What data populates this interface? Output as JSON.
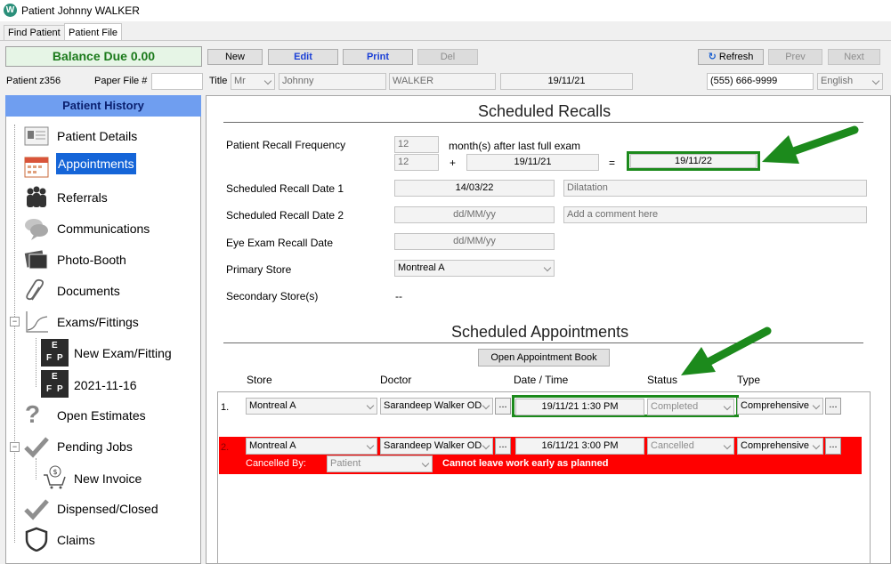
{
  "window": {
    "title": "Patient Johnny WALKER",
    "icon": "W"
  },
  "tabs": [
    {
      "label": "Find Patient"
    },
    {
      "label": "Patient File"
    }
  ],
  "balance": "Balance Due 0.00",
  "toolbar": {
    "new": "New",
    "edit": "Edit",
    "print": "Print",
    "del": "Del",
    "refresh": "Refresh",
    "prev": "Prev",
    "next": "Next"
  },
  "patient": {
    "id_label": "Patient z356",
    "paper_file_label": "Paper File #",
    "paper_file_value": "",
    "title_label": "Title",
    "title_value": "Mr",
    "first_name": "Johnny",
    "last_name": "WALKER",
    "date": "19/11/21",
    "phone": "(555) 666-9999",
    "language": "English"
  },
  "sidebar": {
    "header": "Patient History",
    "items": [
      {
        "label": "Patient Details",
        "icon": "patient-card-icon"
      },
      {
        "label": "Appointments",
        "icon": "calendar-icon"
      },
      {
        "label": "Referrals",
        "icon": "people-icon"
      },
      {
        "label": "Communications",
        "icon": "speech-bubbles-icon"
      },
      {
        "label": "Photo-Booth",
        "icon": "photos-icon"
      },
      {
        "label": "Documents",
        "icon": "paperclip-icon"
      },
      {
        "label": "Exams/Fittings",
        "icon": "chart-icon"
      },
      {
        "label": "New Exam/Fitting",
        "icon": "eye-chart-icon"
      },
      {
        "label": "2021-11-16",
        "icon": "eye-chart-icon"
      },
      {
        "label": "Open Estimates",
        "icon": "question-icon"
      },
      {
        "label": "Pending Jobs",
        "icon": "checkmark-icon"
      },
      {
        "label": "New Invoice",
        "icon": "cart-icon"
      },
      {
        "label": "Dispensed/Closed",
        "icon": "checkmark-icon"
      },
      {
        "label": "Claims",
        "icon": "shield-icon"
      }
    ],
    "ep_letters": {
      "e": "E",
      "f": "F",
      "p": "P"
    }
  },
  "recalls": {
    "title": "Scheduled Recalls",
    "frequency_label": "Patient Recall Frequency",
    "frequency_value": "12",
    "frequency_suffix": "month(s) after last full exam",
    "calc_months": "12",
    "plus": "+",
    "calc_date": "19/11/21",
    "equals": "=",
    "calc_result": "19/11/22",
    "recall1_label": "Scheduled Recall Date 1",
    "recall1_date": "14/03/22",
    "recall1_comment": "Dilatation",
    "recall2_label": "Scheduled Recall Date 2",
    "recall2_date_placeholder": "dd/MM/yy",
    "recall2_comment_placeholder": "Add a comment here",
    "eye_exam_label": "Eye Exam Recall Date",
    "eye_exam_placeholder": "dd/MM/yy",
    "primary_store_label": "Primary Store",
    "primary_store_value": "Montreal A",
    "secondary_store_label": "Secondary Store(s)",
    "secondary_store_value": "--"
  },
  "appointments": {
    "title": "Scheduled Appointments",
    "open_book": "Open Appointment Book",
    "columns": {
      "store": "Store",
      "doctor": "Doctor",
      "datetime": "Date / Time",
      "status": "Status",
      "type": "Type"
    },
    "rows": [
      {
        "num": "1.",
        "store": "Montreal A",
        "doctor": "Sarandeep Walker OD",
        "datetime": "19/11/21 1:30 PM",
        "status": "Completed",
        "type": "Comprehensive"
      },
      {
        "num": "2.",
        "store": "Montreal A",
        "doctor": "Sarandeep Walker OD",
        "datetime": "16/11/21 3:00 PM",
        "status": "Cancelled",
        "type": "Comprehensive",
        "cancelled_by_label": "Cancelled By:",
        "cancelled_by_value": "Patient",
        "cancel_reason": "Cannot leave work early as planned"
      }
    ],
    "dots": "..."
  },
  "colors": {
    "accent_blue": "#1565d8",
    "highlight_green": "#1c8a1c",
    "cancel_red": "#ff0000"
  }
}
